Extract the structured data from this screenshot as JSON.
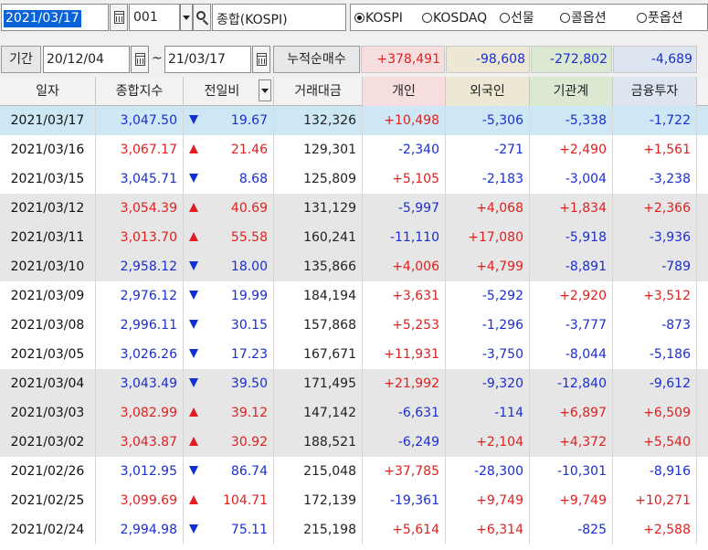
{
  "toolbar": {
    "selected_date": "2021/03/17",
    "code": "001",
    "index_name": "종합(KOSPI)",
    "radios": [
      {
        "label": "KOSPI",
        "selected": true
      },
      {
        "label": "KOSDAQ",
        "selected": false
      },
      {
        "label": "선물",
        "selected": false
      },
      {
        "label": "콜옵션",
        "selected": false
      },
      {
        "label": "풋옵션",
        "selected": false
      }
    ]
  },
  "period": {
    "label": "기간",
    "start": "20/12/04",
    "tilde": "~",
    "end": "21/03/17",
    "net_label": "누적순매수",
    "sums": [
      "+378,491",
      "-98,608",
      "-272,802",
      "-4,689"
    ]
  },
  "colors": {
    "up": "#e02020",
    "down": "#1a2ed0",
    "selected_row": "#cde8f4",
    "gray_row": "#e6e6e6",
    "individual_header": "#f7dede",
    "foreign_header": "#ece8d4",
    "institution_header": "#dbe9d2",
    "finance_header": "#dde6f0"
  },
  "table": {
    "headers": [
      "일자",
      "종합지수",
      "전일비",
      "거래대금",
      "개인",
      "외국인",
      "기관계",
      "금융투자"
    ],
    "rows": [
      {
        "date": "2021/03/17",
        "index": "3,047.50",
        "dir": "down",
        "change": "19.67",
        "amount": "132,326",
        "individual": "+10,498",
        "foreign": "-5,306",
        "institution": "-5,338",
        "finance": "-1,722",
        "bg": "selected"
      },
      {
        "date": "2021/03/16",
        "index": "3,067.17",
        "dir": "up",
        "change": "21.46",
        "amount": "129,301",
        "individual": "-2,340",
        "foreign": "-271",
        "institution": "+2,490",
        "finance": "+1,561",
        "bg": "white"
      },
      {
        "date": "2021/03/15",
        "index": "3,045.71",
        "dir": "down",
        "change": "8.68",
        "amount": "125,809",
        "individual": "+5,105",
        "foreign": "-2,183",
        "institution": "-3,004",
        "finance": "-3,238",
        "bg": "white"
      },
      {
        "date": "2021/03/12",
        "index": "3,054.39",
        "dir": "up",
        "change": "40.69",
        "amount": "131,129",
        "individual": "-5,997",
        "foreign": "+4,068",
        "institution": "+1,834",
        "finance": "+2,366",
        "bg": "gray"
      },
      {
        "date": "2021/03/11",
        "index": "3,013.70",
        "dir": "up",
        "change": "55.58",
        "amount": "160,241",
        "individual": "-11,110",
        "foreign": "+17,080",
        "institution": "-5,918",
        "finance": "-3,936",
        "bg": "gray"
      },
      {
        "date": "2021/03/10",
        "index": "2,958.12",
        "dir": "down",
        "change": "18.00",
        "amount": "135,866",
        "individual": "+4,006",
        "foreign": "+4,799",
        "institution": "-8,891",
        "finance": "-789",
        "bg": "gray"
      },
      {
        "date": "2021/03/09",
        "index": "2,976.12",
        "dir": "down",
        "change": "19.99",
        "amount": "184,194",
        "individual": "+3,631",
        "foreign": "-5,292",
        "institution": "+2,920",
        "finance": "+3,512",
        "bg": "white"
      },
      {
        "date": "2021/03/08",
        "index": "2,996.11",
        "dir": "down",
        "change": "30.15",
        "amount": "157,868",
        "individual": "+5,253",
        "foreign": "-1,296",
        "institution": "-3,777",
        "finance": "-873",
        "bg": "white"
      },
      {
        "date": "2021/03/05",
        "index": "3,026.26",
        "dir": "down",
        "change": "17.23",
        "amount": "167,671",
        "individual": "+11,931",
        "foreign": "-3,750",
        "institution": "-8,044",
        "finance": "-5,186",
        "bg": "white"
      },
      {
        "date": "2021/03/04",
        "index": "3,043.49",
        "dir": "down",
        "change": "39.50",
        "amount": "171,495",
        "individual": "+21,992",
        "foreign": "-9,320",
        "institution": "-12,840",
        "finance": "-9,612",
        "bg": "gray"
      },
      {
        "date": "2021/03/03",
        "index": "3,082.99",
        "dir": "up",
        "change": "39.12",
        "amount": "147,142",
        "individual": "-6,631",
        "foreign": "-114",
        "institution": "+6,897",
        "finance": "+6,509",
        "bg": "gray"
      },
      {
        "date": "2021/03/02",
        "index": "3,043.87",
        "dir": "up",
        "change": "30.92",
        "amount": "188,521",
        "individual": "-6,249",
        "foreign": "+2,104",
        "institution": "+4,372",
        "finance": "+5,540",
        "bg": "gray"
      },
      {
        "date": "2021/02/26",
        "index": "3,012.95",
        "dir": "down",
        "change": "86.74",
        "amount": "215,048",
        "individual": "+37,785",
        "foreign": "-28,300",
        "institution": "-10,301",
        "finance": "-8,916",
        "bg": "white"
      },
      {
        "date": "2021/02/25",
        "index": "3,099.69",
        "dir": "up",
        "change": "104.71",
        "amount": "172,139",
        "individual": "-19,361",
        "foreign": "+9,749",
        "institution": "+9,749",
        "finance": "+10,271",
        "bg": "white"
      },
      {
        "date": "2021/02/24",
        "index": "2,994.98",
        "dir": "down",
        "change": "75.11",
        "amount": "215,198",
        "individual": "+5,614",
        "foreign": "+6,314",
        "institution": "-825",
        "finance": "+2,588",
        "bg": "white"
      }
    ]
  }
}
